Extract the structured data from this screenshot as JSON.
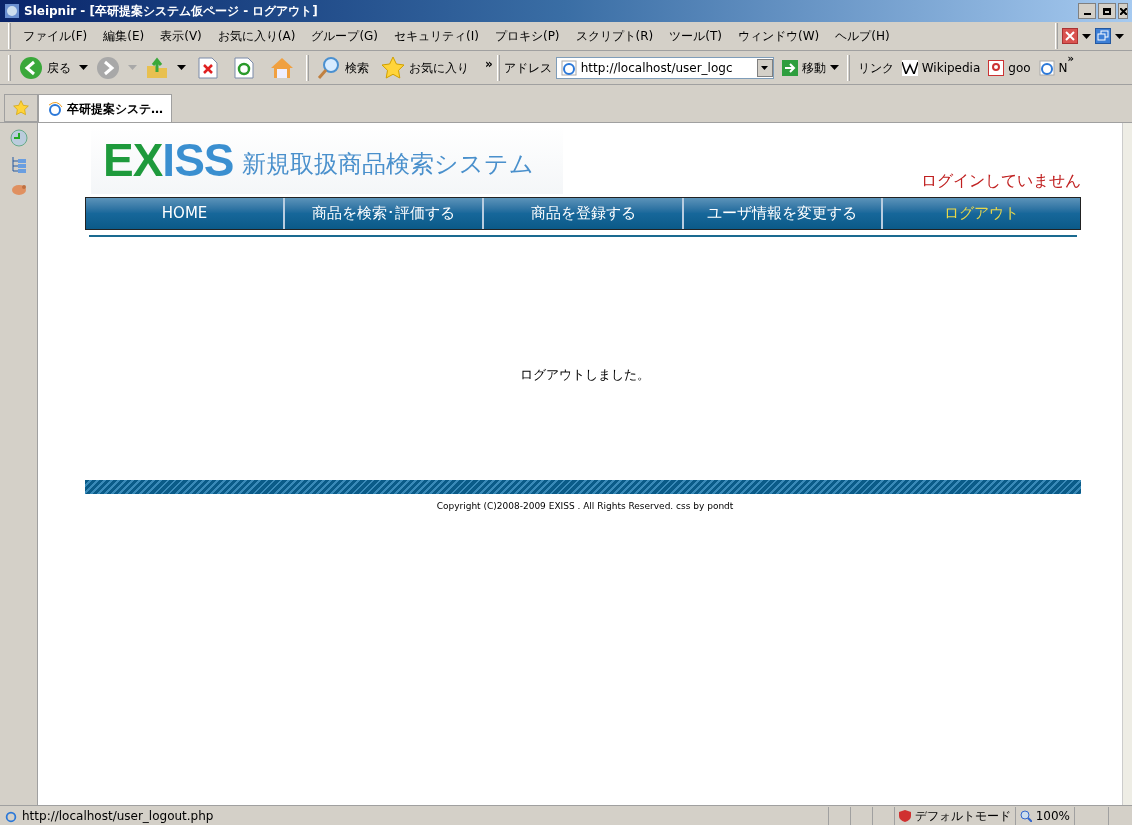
{
  "window": {
    "title": "Sleipnir - [卒研提案システム仮ページ - ログアウト]"
  },
  "menu": [
    "ファイル(F)",
    "編集(E)",
    "表示(V)",
    "お気に入り(A)",
    "グループ(G)",
    "セキュリティ(I)",
    "プロキシ(P)",
    "スクリプト(R)",
    "ツール(T)",
    "ウィンドウ(W)",
    "ヘルプ(H)"
  ],
  "toolbar": {
    "back": "戻る",
    "search": "検索",
    "favorites": "お気に入り",
    "more": "»",
    "address_label": "アドレス",
    "address": "http://localhost/user_logc",
    "go": "移動",
    "links_label": "リンク",
    "links": [
      "Wikipedia",
      "goo",
      "N"
    ],
    "links_more": "»"
  },
  "tabs": [
    {
      "label": "卒研提案システ…",
      "selected": true
    }
  ],
  "page": {
    "logo": "EXISS",
    "subtitle": "新規取扱商品検索システム",
    "login_status": "ログインしていません",
    "nav": [
      {
        "label": "HOME",
        "selected": false
      },
      {
        "label": "商品を検索･評価する",
        "selected": false
      },
      {
        "label": "商品を登録する",
        "selected": false
      },
      {
        "label": "ユーザ情報を変更する",
        "selected": false
      },
      {
        "label": "ログアウト",
        "selected": true
      }
    ],
    "message": "ログアウトしました。",
    "copyright": "Copyright (C)2008-2009 EXISS . All Rights Reserved. css by pondt"
  },
  "status_bar": {
    "url": "http://localhost/user_logout.php",
    "mode": "デフォルトモード",
    "zoom": "100%"
  }
}
